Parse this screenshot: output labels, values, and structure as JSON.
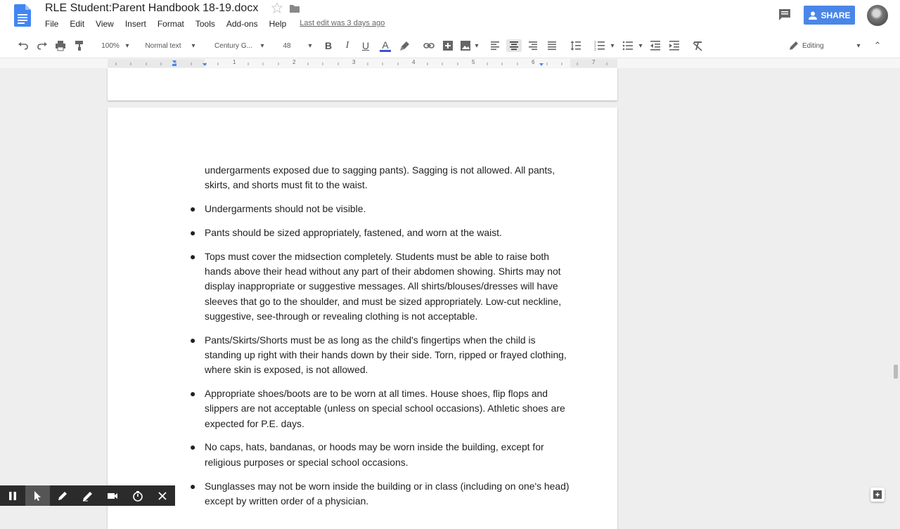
{
  "document": {
    "title": "RLE Student:Parent Handbook 18-19.docx",
    "last_edit": "Last edit was 3 days ago"
  },
  "menu": [
    "File",
    "Edit",
    "View",
    "Insert",
    "Format",
    "Tools",
    "Add-ons",
    "Help"
  ],
  "header": {
    "share_label": "SHARE"
  },
  "toolbar": {
    "zoom": "100%",
    "style": "Normal text",
    "font": "Century G...",
    "font_size": "48",
    "mode": "Editing",
    "text_color": "#3c52d6"
  },
  "ruler": {
    "numbers": [
      "1",
      "1",
      "2",
      "3",
      "4",
      "5",
      "6",
      "7"
    ]
  },
  "content": {
    "continuation": "undergarments exposed due to sagging pants).  Sagging is not allowed.  All pants, skirts, and shorts must fit to the waist.",
    "bullets": [
      "Undergarments should not be visible.",
      "Pants should be sized appropriately, fastened, and worn at the waist.",
      "Tops must cover the midsection completely.  Students must be able to raise both hands above their head without any part of their abdomen showing.  Shirts may not display inappropriate or suggestive messages.  All shirts/blouses/dresses will have sleeves that go to the shoulder, and must be sized appropriately.  Low-cut neckline, suggestive, see-through or revealing clothing is not acceptable.",
      "Pants/Skirts/Shorts must be as long as the child's fingertips when the child is standing up right with their hands down by their side.  Torn, ripped or frayed clothing, where skin is exposed, is not allowed.",
      "Appropriate shoes/boots are to be worn at all times. House shoes, flip flops and slippers are not acceptable (unless on special school occasions).  Athletic shoes are expected for P.E. days.",
      "No caps, hats, bandanas, or hoods may be worn inside the building, except for religious purposes or special school occasions.",
      "Sunglasses may not be worn inside the building or in class (including on one's head) except by written order of a physician."
    ]
  },
  "colors": {
    "share_button": "#4a86e8",
    "recorder_bar": "#2b2b2b"
  }
}
